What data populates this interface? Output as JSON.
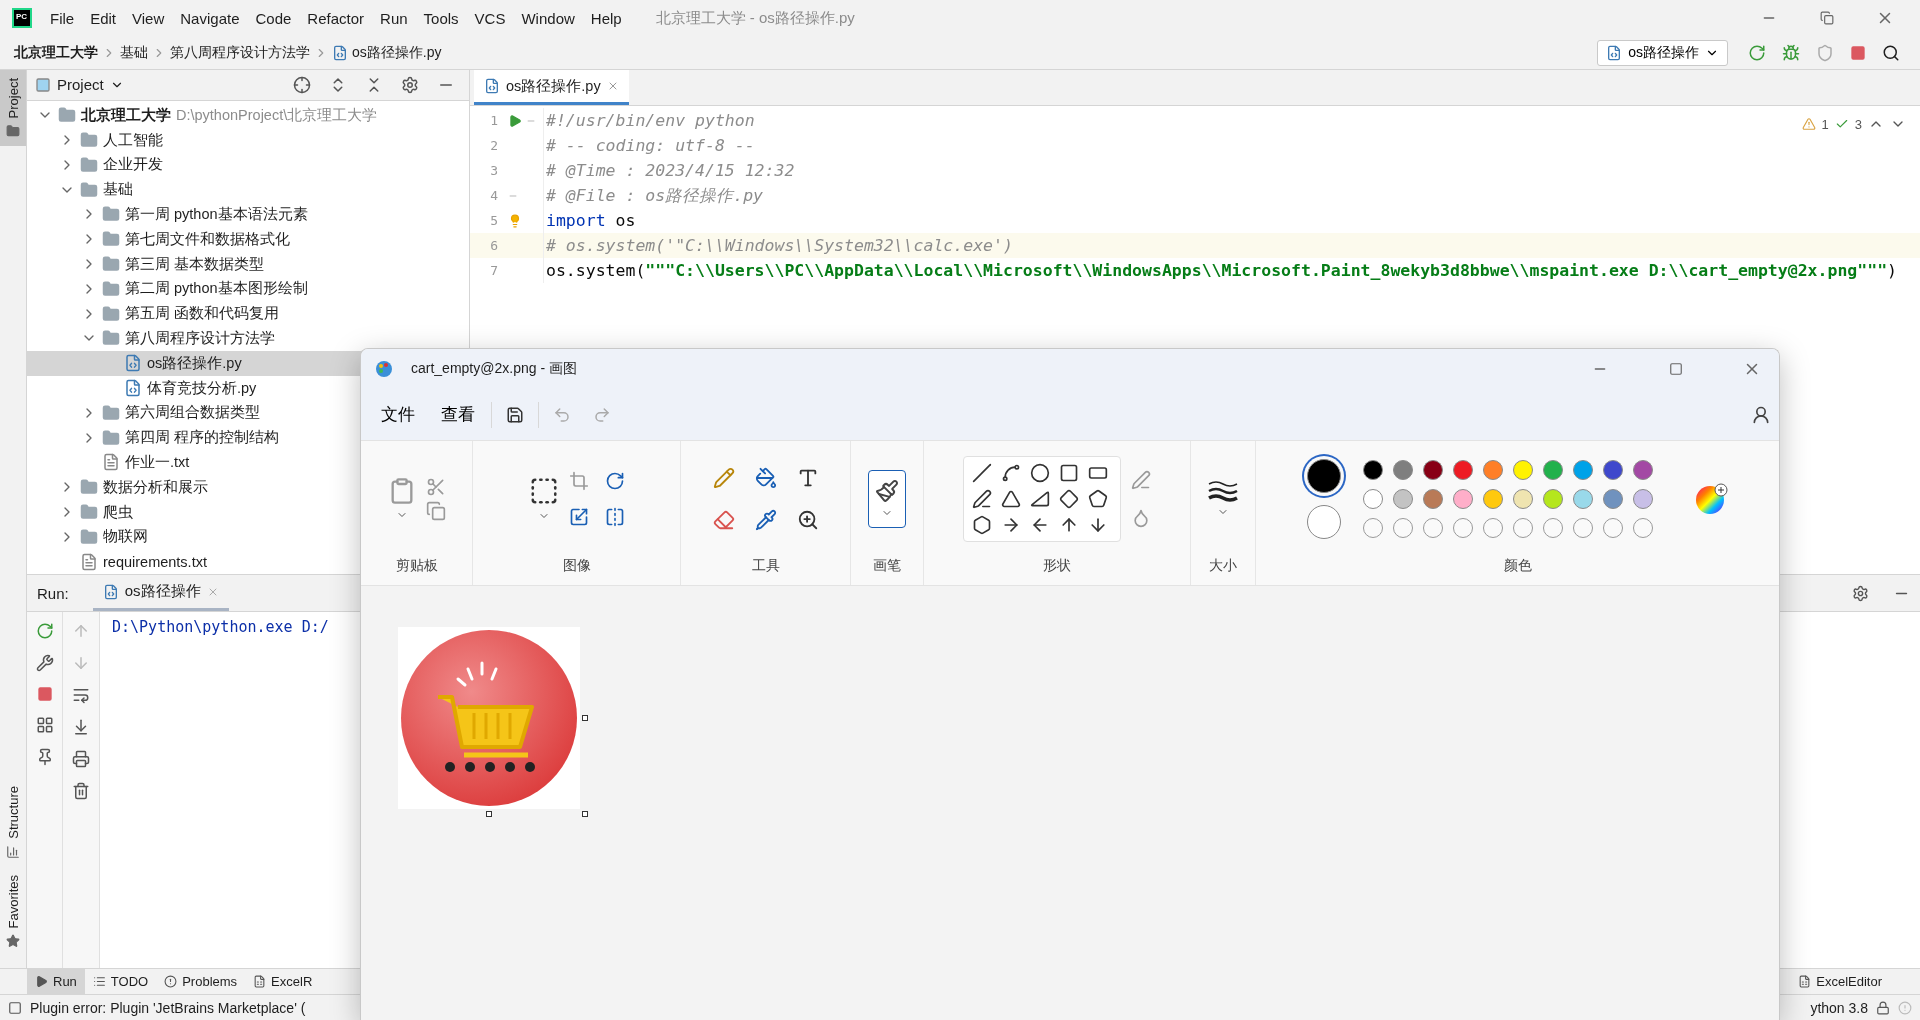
{
  "app": {
    "logo": "PC",
    "menu": [
      "File",
      "Edit",
      "View",
      "Navigate",
      "Code",
      "Refactor",
      "Run",
      "Tools",
      "VCS",
      "Window",
      "Help"
    ],
    "title": "北京理工大学 - os路径操作.py"
  },
  "breadcrumb": [
    "北京理工大学",
    "基础",
    "第八周程序设计方法学",
    "os路径操作.py"
  ],
  "run_config": {
    "label": "os路径操作"
  },
  "side_tabs": [
    {
      "label": "Project",
      "selected": true
    },
    {
      "label": "Structure",
      "selected": false
    },
    {
      "label": "Favorites",
      "selected": false
    }
  ],
  "project": {
    "title": "Project",
    "tree": [
      {
        "label": "北京理工大学",
        "path": "D:\\pythonProject\\北京理工大学",
        "kind": "folder",
        "expanded": true,
        "selected": false,
        "children": [
          {
            "label": "人工智能",
            "kind": "folder",
            "expanded": false,
            "selected": false
          },
          {
            "label": "企业开发",
            "kind": "folder",
            "expanded": false,
            "selected": false
          },
          {
            "label": "基础",
            "kind": "folder",
            "expanded": true,
            "selected": false,
            "children": [
              {
                "label": "第一周 python基本语法元素",
                "kind": "folder",
                "expanded": false,
                "selected": false
              },
              {
                "label": "第七周文件和数据格式化",
                "kind": "folder",
                "expanded": false,
                "selected": false
              },
              {
                "label": "第三周 基本数据类型",
                "kind": "folder",
                "expanded": false,
                "selected": false
              },
              {
                "label": "第二周 python基本图形绘制",
                "kind": "folder",
                "expanded": false,
                "selected": false
              },
              {
                "label": "第五周 函数和代码复用",
                "kind": "folder",
                "expanded": false,
                "selected": false
              },
              {
                "label": "第八周程序设计方法学",
                "kind": "folder",
                "expanded": true,
                "selected": false,
                "children": [
                  {
                    "label": "os路径操作.py",
                    "kind": "python",
                    "selected": true
                  },
                  {
                    "label": "体育竞技分析.py",
                    "kind": "python",
                    "selected": false
                  }
                ]
              },
              {
                "label": "第六周组合数据类型",
                "kind": "folder",
                "expanded": false,
                "selected": false
              },
              {
                "label": "第四周 程序的控制结构",
                "kind": "folder",
                "expanded": false,
                "selected": false
              },
              {
                "label": "作业一.txt",
                "kind": "text",
                "selected": false
              }
            ]
          },
          {
            "label": "数据分析和展示",
            "kind": "folder",
            "expanded": false,
            "selected": false
          },
          {
            "label": "爬虫",
            "kind": "folder",
            "expanded": false,
            "selected": false
          },
          {
            "label": "物联网",
            "kind": "folder",
            "expanded": false,
            "selected": false
          },
          {
            "label": "requirements.txt",
            "kind": "text",
            "selected": false
          }
        ]
      }
    ]
  },
  "editor": {
    "tabs": [
      {
        "label": "os路径操作.py",
        "selected": true
      }
    ],
    "warnings": "1",
    "weak_warnings": "3",
    "lines": [
      {
        "number": "1",
        "current": false,
        "segments": [
          {
            "kind": "comment",
            "text": "#!/usr/bin/env python"
          }
        ]
      },
      {
        "number": "2",
        "current": false,
        "segments": [
          {
            "kind": "comment",
            "text": "# -- coding: utf-8 --"
          }
        ]
      },
      {
        "number": "3",
        "current": false,
        "segments": [
          {
            "kind": "comment",
            "text": "# @Time : 2023/4/15 12:32"
          }
        ]
      },
      {
        "number": "4",
        "current": false,
        "segments": [
          {
            "kind": "comment",
            "text": "# @File : os路径操作.py"
          }
        ]
      },
      {
        "number": "5",
        "current": false,
        "segments": [
          {
            "kind": "keyword",
            "text": "import"
          },
          {
            "kind": "plain",
            "text": " os"
          }
        ]
      },
      {
        "number": "6",
        "current": true,
        "segments": [
          {
            "kind": "comment",
            "text": "# os.system('\"C:\\\\Windows\\\\System32\\\\calc.exe')"
          }
        ]
      },
      {
        "number": "7",
        "current": false,
        "segments": [
          {
            "kind": "plain",
            "text": "os.system("
          },
          {
            "kind": "string",
            "text": "\"\"\"C:\\\\Users\\\\PC\\\\AppData\\\\Local\\\\Microsoft\\\\WindowsApps\\\\Microsoft.Paint_8wekyb3d8bbwe\\\\mspaint.exe D:\\\\cart_empty@2x.png\"\"\""
          },
          {
            "kind": "plain",
            "text": ")"
          }
        ]
      }
    ]
  },
  "run_panel": {
    "label": "Run:",
    "tab": "os路径操作",
    "output": "D:\\Python\\python.exe D:/"
  },
  "tool_tabs": [
    {
      "label": "Run",
      "selected": true
    },
    {
      "label": "TODO",
      "selected": false
    },
    {
      "label": "Problems",
      "selected": false
    },
    {
      "label": "ExcelR",
      "selected": false
    }
  ],
  "right_tool_tab": "ExcelEditor",
  "status": {
    "message": "Plugin error: Plugin 'JetBrains Marketplace' (",
    "interpreter": "ython 3.8"
  },
  "paint": {
    "title": "cart_empty@2x.png - 画图",
    "menu": [
      "文件",
      "查看"
    ],
    "brush": {
      "selected": true
    },
    "groups": [
      "剪贴板",
      "图像",
      "工具",
      "画笔",
      "形状",
      "大小",
      "颜色"
    ],
    "active_colors": [
      {
        "color": "#000000",
        "selected": true
      },
      {
        "color": "#ffffff",
        "selected": false
      }
    ],
    "palette": [
      {
        "kind": "swatch",
        "color": "#000000"
      },
      {
        "kind": "swatch",
        "color": "#7f7f7f"
      },
      {
        "kind": "swatch",
        "color": "#880015"
      },
      {
        "kind": "swatch",
        "color": "#ed1c24"
      },
      {
        "kind": "swatch",
        "color": "#ff7f27"
      },
      {
        "kind": "swatch",
        "color": "#fff200"
      },
      {
        "kind": "swatch",
        "color": "#22b14c"
      },
      {
        "kind": "swatch",
        "color": "#00a2e8"
      },
      {
        "kind": "swatch",
        "color": "#3f48cc"
      },
      {
        "kind": "swatch",
        "color": "#a349a4"
      },
      {
        "kind": "swatch",
        "color": "#ffffff"
      },
      {
        "kind": "swatch",
        "color": "#c3c3c3"
      },
      {
        "kind": "swatch",
        "color": "#b97a57"
      },
      {
        "kind": "swatch",
        "color": "#ffaec9"
      },
      {
        "kind": "swatch",
        "color": "#ffc90e"
      },
      {
        "kind": "swatch",
        "color": "#efe4b0"
      },
      {
        "kind": "swatch",
        "color": "#b5e61d"
      },
      {
        "kind": "swatch",
        "color": "#99d9ea"
      },
      {
        "kind": "swatch",
        "color": "#7092be"
      },
      {
        "kind": "swatch",
        "color": "#c8bfe7"
      },
      {
        "kind": "empty"
      },
      {
        "kind": "empty"
      },
      {
        "kind": "empty"
      },
      {
        "kind": "empty"
      },
      {
        "kind": "empty"
      },
      {
        "kind": "empty"
      },
      {
        "kind": "empty"
      },
      {
        "kind": "empty"
      },
      {
        "kind": "empty"
      },
      {
        "kind": "empty"
      }
    ]
  }
}
